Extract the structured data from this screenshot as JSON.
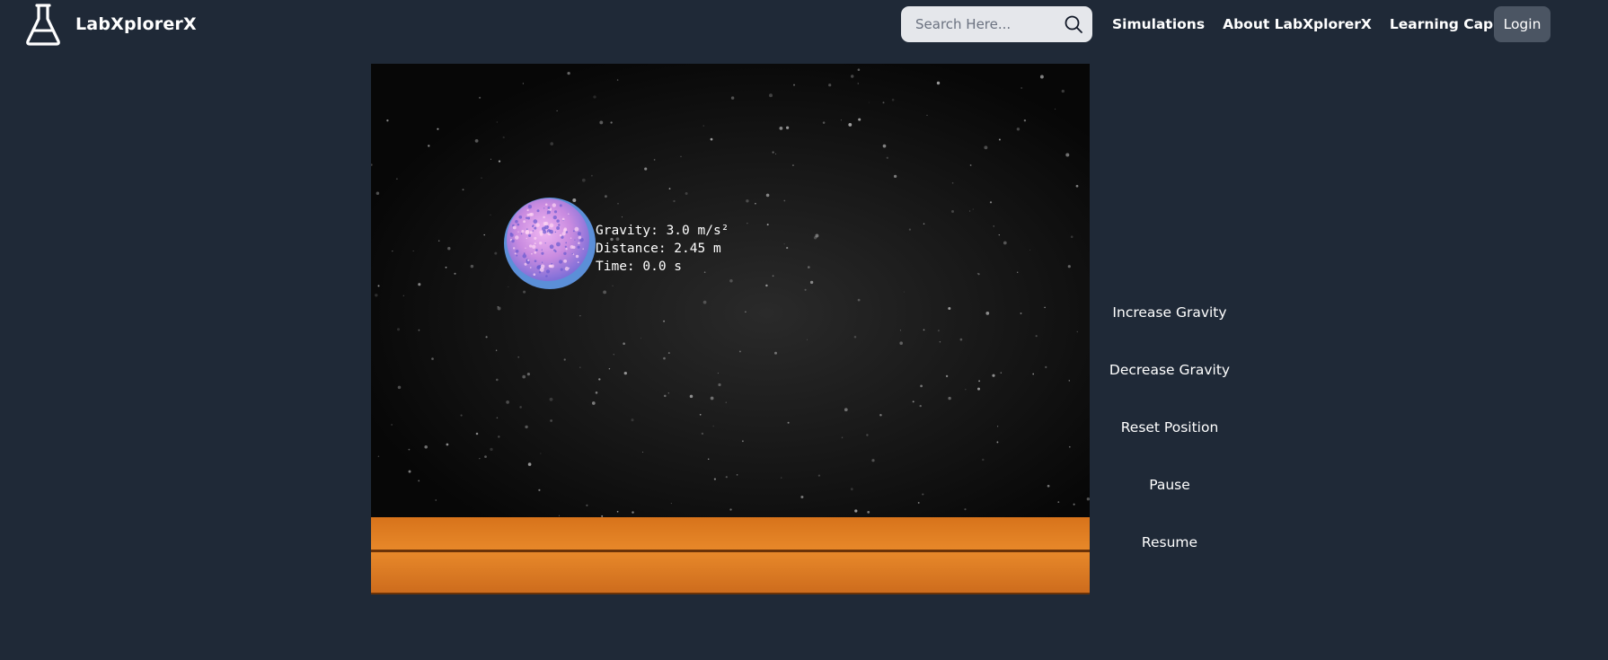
{
  "header": {
    "brand_name": "LabXplorerX",
    "search": {
      "placeholder": "Search Here...",
      "value": ""
    },
    "nav": [
      {
        "label": "Simulations"
      },
      {
        "label": "About LabXplorerX"
      },
      {
        "label": "Learning Capsules"
      }
    ],
    "login_label": "Login"
  },
  "simulation": {
    "gravity_text": "Gravity: 3.0 m/s²",
    "distance_text": "Distance: 2.45 m",
    "time_text": "Time: 0.0 s"
  },
  "controls": [
    {
      "label": "Increase Gravity"
    },
    {
      "label": "Decrease Gravity"
    },
    {
      "label": "Reset Position"
    },
    {
      "label": "Pause"
    },
    {
      "label": "Resume"
    }
  ],
  "icons": {
    "logo": "flask-icon",
    "search": "search-icon"
  },
  "colors": {
    "background": "#1f2937",
    "search_bg": "#e5e7eb",
    "login_bg": "#4b5563",
    "floor": "#e8892a",
    "ball": "#c98be0"
  }
}
